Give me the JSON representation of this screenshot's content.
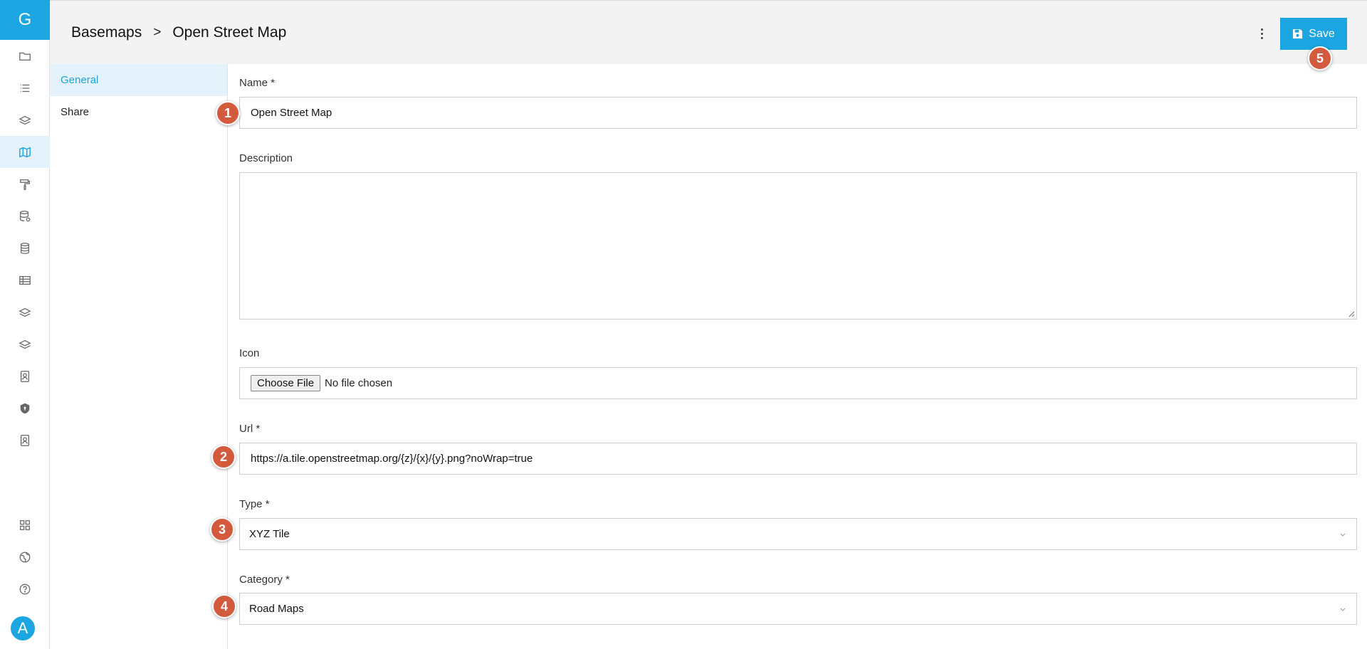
{
  "rail": {
    "logo_letter": "G",
    "avatar_letter": "A",
    "icons": [
      "folder-icon",
      "list-icon",
      "layers-icon",
      "map-icon",
      "paint-roller-icon",
      "database-settings-icon",
      "database-icon",
      "table-icon",
      "layers-icon",
      "layers-icon",
      "contact-card-icon",
      "shield-icon",
      "contact-card-icon",
      "grid-icon",
      "globe-icon",
      "help-icon"
    ]
  },
  "header": {
    "breadcrumb": [
      "Basemaps",
      ">",
      "Open Street Map"
    ],
    "save_label": "Save"
  },
  "sidenav": {
    "items": [
      {
        "label": "General",
        "active": true
      },
      {
        "label": "Share",
        "active": false
      }
    ]
  },
  "form": {
    "name_label": "Name *",
    "name_value": "Open Street Map",
    "description_label": "Description",
    "description_value": "",
    "icon_label": "Icon",
    "file_button": "Choose File",
    "file_status": "No file chosen",
    "url_label": "Url *",
    "url_value": "https://a.tile.openstreetmap.org/{z}/{x}/{y}.png?noWrap=true",
    "type_label": "Type *",
    "type_value": "XYZ Tile",
    "category_label": "Category *",
    "category_value": "Road Maps"
  },
  "badges": [
    "1",
    "2",
    "3",
    "4",
    "5"
  ],
  "colors": {
    "accent": "#1ba5e1",
    "badge": "#d35a3d"
  }
}
